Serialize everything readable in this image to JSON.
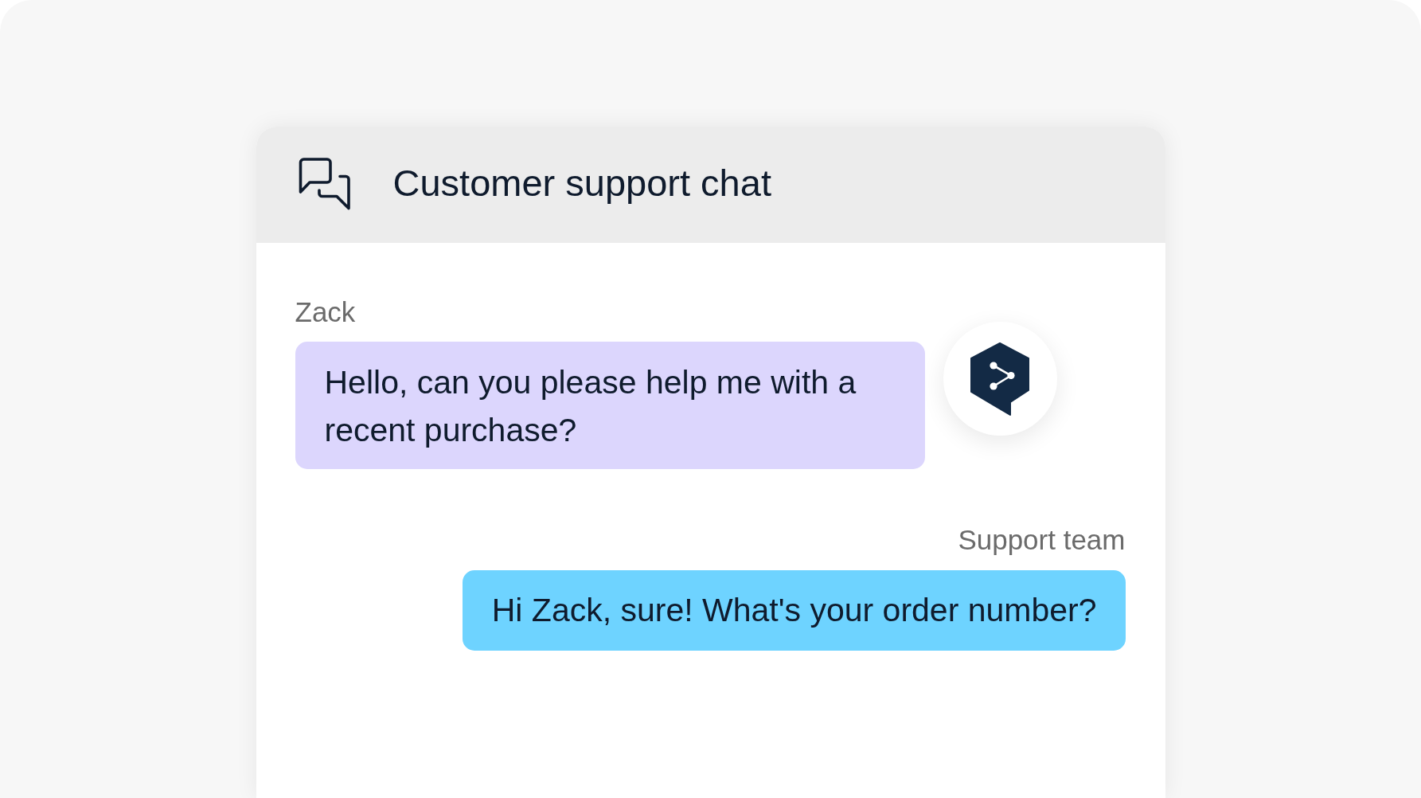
{
  "header": {
    "title": "Customer support chat"
  },
  "messages": [
    {
      "kind": "customer",
      "sender": "Zack",
      "text": "Hello, can you please help me with a recent purchase?",
      "logo": true
    },
    {
      "kind": "agent",
      "sender": "Support team",
      "text": "Hi Zack, sure! What's your order number?",
      "logo": false
    }
  ]
}
